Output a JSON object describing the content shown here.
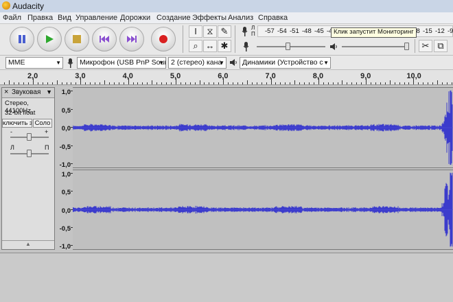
{
  "window": {
    "title": "Audacity"
  },
  "menu": [
    "Файл",
    "Правка",
    "Вид",
    "Управление",
    "Дорожки",
    "Создание",
    "Эффекты",
    "Анализ",
    "Справка"
  ],
  "transport": {
    "buttons": [
      {
        "name": "pause-button",
        "icon": "pause-icon"
      },
      {
        "name": "play-button",
        "icon": "play-icon"
      },
      {
        "name": "stop-button",
        "icon": "stop-icon"
      },
      {
        "name": "skip-start-button",
        "icon": "skip-start-icon"
      },
      {
        "name": "skip-end-button",
        "icon": "skip-end-icon"
      },
      {
        "name": "record-button",
        "icon": "record-icon"
      }
    ]
  },
  "tools": {
    "row1": [
      "I",
      "⧖",
      "✎"
    ],
    "row2": [
      "⌕",
      "↔",
      "✱"
    ]
  },
  "meters": {
    "record_channels": [
      "Л",
      "П"
    ],
    "scale": [
      "-57",
      "-54",
      "-51",
      "-48",
      "-45",
      "-42"
    ],
    "scale_right": [
      "-18",
      "-15",
      "-12",
      "-9"
    ],
    "tooltip": "Клик запустит Мониторинг"
  },
  "mixer": {
    "record_level": 0.45,
    "playback_level": 1.0
  },
  "devices": {
    "host": "MME",
    "input": "Микрофон (USB PnP Sour",
    "channels": "2 (стерео) кана",
    "output": "Динамики (Устройство с"
  },
  "ruler": {
    "labels": [
      "2,0",
      "3,0",
      "4,0",
      "5,0",
      "6,0",
      "7,0",
      "8,0",
      "9,0",
      "10,0"
    ]
  },
  "track": {
    "name": "Звуковая",
    "close": "×",
    "format": "Стерео, 44100Hz",
    "bitdepth": "32-bit float",
    "mute": "ключить зву",
    "solo": "Соло",
    "gain_minus": "-",
    "gain_plus": "+",
    "pan_left": "Л",
    "pan_right": "П",
    "collapse": "▲"
  },
  "vscale": [
    "1,0",
    "0,5",
    "0,0",
    "-0,5",
    "-1,0"
  ],
  "colors": {
    "waveform": "#3b3bcc",
    "track_bg": "#c0c0c0",
    "record": "#d92020",
    "play": "#2ea82e"
  }
}
